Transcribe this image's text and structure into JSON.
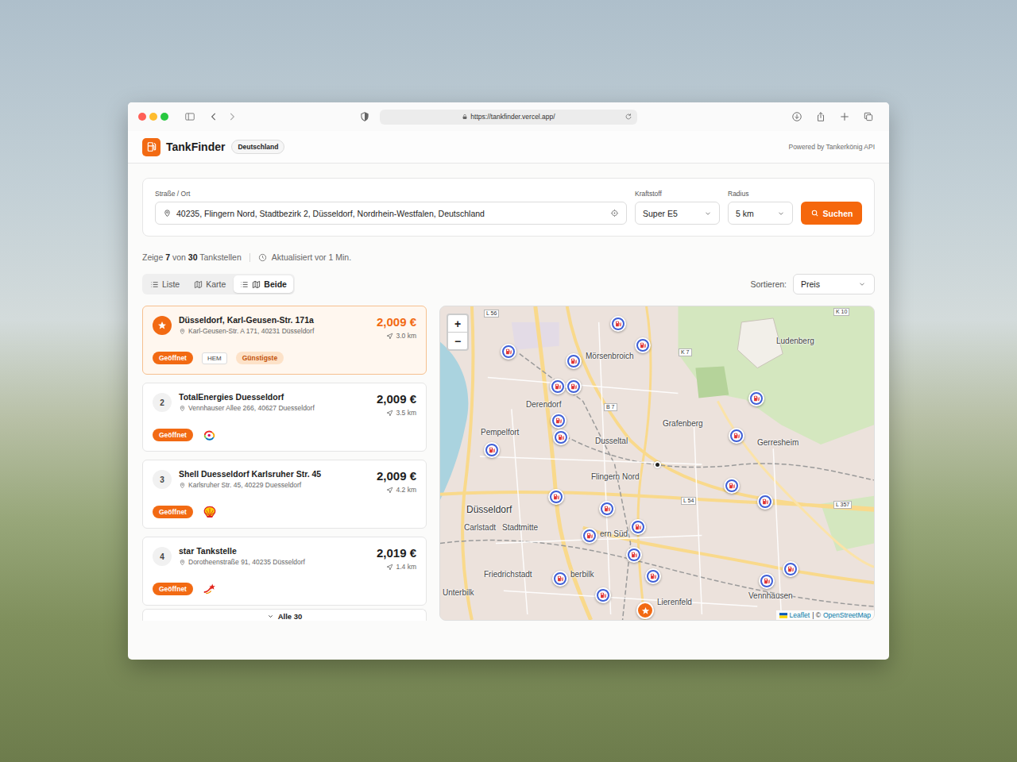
{
  "browser": {
    "url": "https://tankfinder.vercel.app/"
  },
  "header": {
    "brand": "TankFinder",
    "country": "Deutschland",
    "powered_by": "Powered by Tankerkönig API"
  },
  "search": {
    "address_label": "Straße / Ort",
    "address": "40235, Flingern Nord, Stadtbezirk 2, Düsseldorf, Nordrhein-Westfalen, Deutschland",
    "fuel_label": "Kraftstoff",
    "fuel": "Super E5",
    "radius_label": "Radius",
    "radius": "5 km",
    "button": "Suchen"
  },
  "summary": {
    "prefix": "Zeige",
    "shown": "7",
    "middle": "von",
    "total": "30",
    "suffix": "Tankstellen",
    "updated": "Aktualisiert vor 1 Min."
  },
  "views": [
    {
      "label": "Liste",
      "selected": false
    },
    {
      "label": "Karte",
      "selected": false
    },
    {
      "label": "Beide",
      "selected": true
    }
  ],
  "sort": {
    "label": "Sortieren:",
    "value": "Preis"
  },
  "stations": [
    {
      "kind": "best",
      "highlighted": true,
      "name": "Düsseldorf, Karl-Geusen-Str. 171a",
      "address": "Karl-Geusen-Str. A 171, 40231 Düsseldorf",
      "price": "2,009 €",
      "distance": "3.0 km",
      "status": "Geöffnet",
      "brand": {
        "kind": "text",
        "label": "HEM"
      },
      "badge": "Günstigste"
    },
    {
      "kind": "number",
      "rank": "2",
      "highlighted": false,
      "name": "TotalEnergies Duesseldorf",
      "address": "Vennhauser Allee 266, 40627 Duesseldorf",
      "price": "2,009 €",
      "distance": "3.5 km",
      "status": "Geöffnet",
      "brand": {
        "kind": "totalenergies"
      }
    },
    {
      "kind": "number",
      "rank": "3",
      "highlighted": false,
      "name": "Shell Duesseldorf Karlsruher Str. 45",
      "address": "Karlsruher Str. 45, 40229 Duesseldorf",
      "price": "2,009 €",
      "distance": "4.2 km",
      "status": "Geöffnet",
      "brand": {
        "kind": "shell"
      }
    },
    {
      "kind": "number",
      "rank": "4",
      "highlighted": false,
      "name": "star Tankstelle",
      "address": "Dorotheenstraße 91, 40235 Düsseldorf",
      "price": "2,019 €",
      "distance": "1.4 km",
      "status": "Geöffnet",
      "brand": {
        "kind": "star"
      }
    }
  ],
  "show_all": "Alle 30",
  "map": {
    "zoom_in": "+",
    "zoom_out": "−",
    "labels": [
      {
        "text": "L 56",
        "kind": "road"
      },
      {
        "text": "K 10",
        "kind": "road"
      },
      {
        "text": "Mörsenbroich",
        "kind": "district"
      },
      {
        "text": "Ludenberg",
        "kind": "district"
      },
      {
        "text": "K 7",
        "kind": "road"
      },
      {
        "text": "Derendorf",
        "kind": "district"
      },
      {
        "text": "B 7",
        "kind": "road"
      },
      {
        "text": "Grafenberg",
        "kind": "district"
      },
      {
        "text": "Pempelfort",
        "kind": "district"
      },
      {
        "text": "Dusseltal",
        "kind": "district"
      },
      {
        "text": "Gerresheim",
        "kind": "district"
      },
      {
        "text": "Flingern Nord",
        "kind": "district"
      },
      {
        "text": "L 54",
        "kind": "road"
      },
      {
        "text": "L 357",
        "kind": "road"
      },
      {
        "text": "Düsseldorf",
        "kind": "city"
      },
      {
        "text": "Carlstadt",
        "kind": "district"
      },
      {
        "text": "Stadtmitte",
        "kind": "district"
      },
      {
        "text": "ern Süd",
        "kind": "district"
      },
      {
        "text": "Friedrichstadt",
        "kind": "district"
      },
      {
        "text": "berbilk",
        "kind": "district"
      },
      {
        "text": "Unterbilk",
        "kind": "district"
      },
      {
        "text": "Lierenfeld",
        "kind": "district"
      },
      {
        "text": "Vennhausen",
        "kind": "district"
      }
    ],
    "markers": [
      {
        "kind": "station"
      },
      {
        "kind": "station"
      },
      {
        "kind": "station"
      },
      {
        "kind": "station"
      },
      {
        "kind": "station"
      },
      {
        "kind": "station"
      },
      {
        "kind": "station"
      },
      {
        "kind": "station"
      },
      {
        "kind": "station"
      },
      {
        "kind": "station"
      },
      {
        "kind": "station"
      },
      {
        "kind": "station"
      },
      {
        "kind": "station"
      },
      {
        "kind": "station"
      },
      {
        "kind": "station"
      },
      {
        "kind": "station"
      },
      {
        "kind": "station"
      },
      {
        "kind": "station"
      },
      {
        "kind": "station"
      },
      {
        "kind": "station"
      },
      {
        "kind": "station"
      },
      {
        "kind": "station"
      },
      {
        "kind": "station"
      },
      {
        "kind": "cheapest"
      },
      {
        "kind": "location"
      }
    ],
    "attribution": {
      "leaflet": "Leaflet",
      "separator": "| ©",
      "osm": "OpenStreetMap"
    }
  }
}
